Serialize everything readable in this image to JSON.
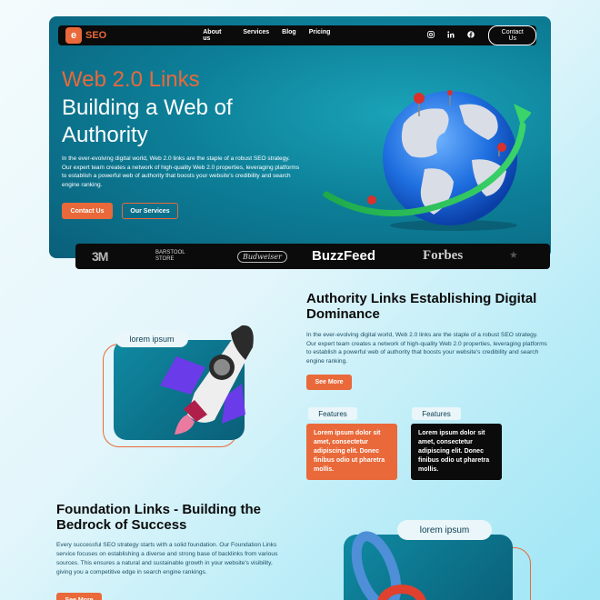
{
  "brand": {
    "mark": "e",
    "name": "SEO"
  },
  "nav": {
    "links": [
      "About us",
      "Services",
      "Blog",
      "Pricing"
    ],
    "social": [
      "instagram-icon",
      "linkedin-icon",
      "facebook-icon"
    ],
    "contact_label": "Contact Us"
  },
  "hero": {
    "title_line1": "Web 2.0 Links",
    "title_line2": "Building a Web of Authority",
    "description": "In the ever-evolving digital world, Web 2.0 links are the staple of a robust SEO strategy. Our expert team creates a network of high-quality Web 2.0 properties, leveraging platforms to establish a powerful web of authority that boosts your website's credibility and search engine ranking.",
    "contact_label": "Contact Us",
    "services_label": "Our Services"
  },
  "logos": {
    "brand1": "3M",
    "brand2_line1": "BARSTOOL",
    "brand2_line2": "STORE",
    "brand3": "Budweiser",
    "brand4": "BuzzFeed",
    "brand5": "Forbes",
    "brand6": "★"
  },
  "section_authority": {
    "title": "Authority Links Establishing Digital Dominance",
    "description": "In the ever-evolving digital world, Web 2.0 links are the staple of a robust SEO strategy. Our expert team creates a network of high-quality Web 2.0 properties, leveraging platforms to establish a powerful web of authority that boosts your website's credibility and search engine ranking.",
    "see_more_label": "See More",
    "image_label": "lorem ipsum",
    "features": [
      {
        "label": "Features",
        "text": "Lorem ipsum dolor sit amet, consectetur adipiscing elit. Donec finibus odio ut pharetra mollis."
      },
      {
        "label": "Features",
        "text": "Lorem ipsum dolor sit amet, consectetur adipiscing elit. Donec finibus odio ut pharetra mollis."
      }
    ]
  },
  "section_foundation": {
    "title": "Foundation Links - Building the Bedrock of Success",
    "description": "Every successful SEO strategy starts with a solid foundation. Our Foundation Links service focuses on establishing a diverse and strong base of backlinks from various sources. This ensures a natural and sustainable growth in your website's visibility, giving you a competitive edge in search engine rankings.",
    "see_more_label": "See More",
    "image_label": "lorem ipsum"
  },
  "colors": {
    "accent": "#e9693a",
    "hero_bg": "#0d7f98",
    "dark": "#0b0b0b"
  }
}
